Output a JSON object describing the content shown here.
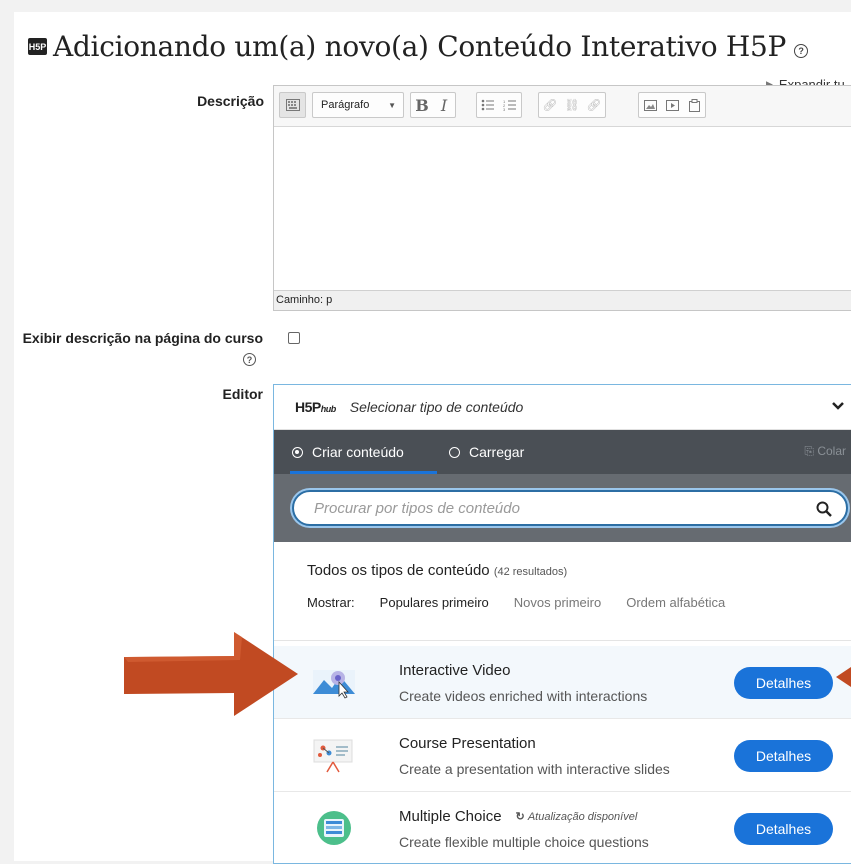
{
  "heading": {
    "title": "Adicionando um(a) novo(a) Conteúdo Interativo H5P",
    "logo_text": "H5P",
    "help": "?"
  },
  "expand_link": "Expandir tu",
  "description": {
    "label": "Descrição",
    "toolbar": {
      "format_select": "Parágrafo",
      "bold": "B",
      "italic": "I"
    },
    "status": "Caminho: p"
  },
  "show_description": {
    "label": "Exibir descrição na página do curso",
    "checked": false
  },
  "editor": {
    "label": "Editor",
    "hub": {
      "logo": "H5P",
      "logo_suffix": "hub",
      "select_title": "Selecionar tipo de conteúdo",
      "tabs": [
        {
          "label": "Criar conteúdo",
          "selected": true
        },
        {
          "label": "Carregar",
          "selected": false
        }
      ],
      "paste": "Colar",
      "search_placeholder": "Procurar por tipos de conteúdo",
      "all_types": "Todos os tipos de conteúdo",
      "result_count": "(42 resultados)",
      "show_label": "Mostrar:",
      "sort_options": [
        "Populares primeiro",
        "Novos primeiro",
        "Ordem alfabética"
      ],
      "items": [
        {
          "name": "Interactive Video",
          "desc": "Create videos enriched with interactions",
          "button": "Detalhes",
          "icon": "interactive-video-icon"
        },
        {
          "name": "Course Presentation",
          "desc": "Create a presentation with interactive slides",
          "button": "Detalhes",
          "icon": "course-presentation-icon"
        },
        {
          "name": "Multiple Choice",
          "desc": "Create flexible multiple choice questions",
          "button": "Detalhes",
          "icon": "multiple-choice-icon",
          "update": "Atualização disponível"
        }
      ]
    }
  },
  "colors": {
    "accent": "#1a73d9",
    "tabs_bg": "#4a4f55",
    "search_bg": "#666b71",
    "arrow": "#c14a22"
  }
}
